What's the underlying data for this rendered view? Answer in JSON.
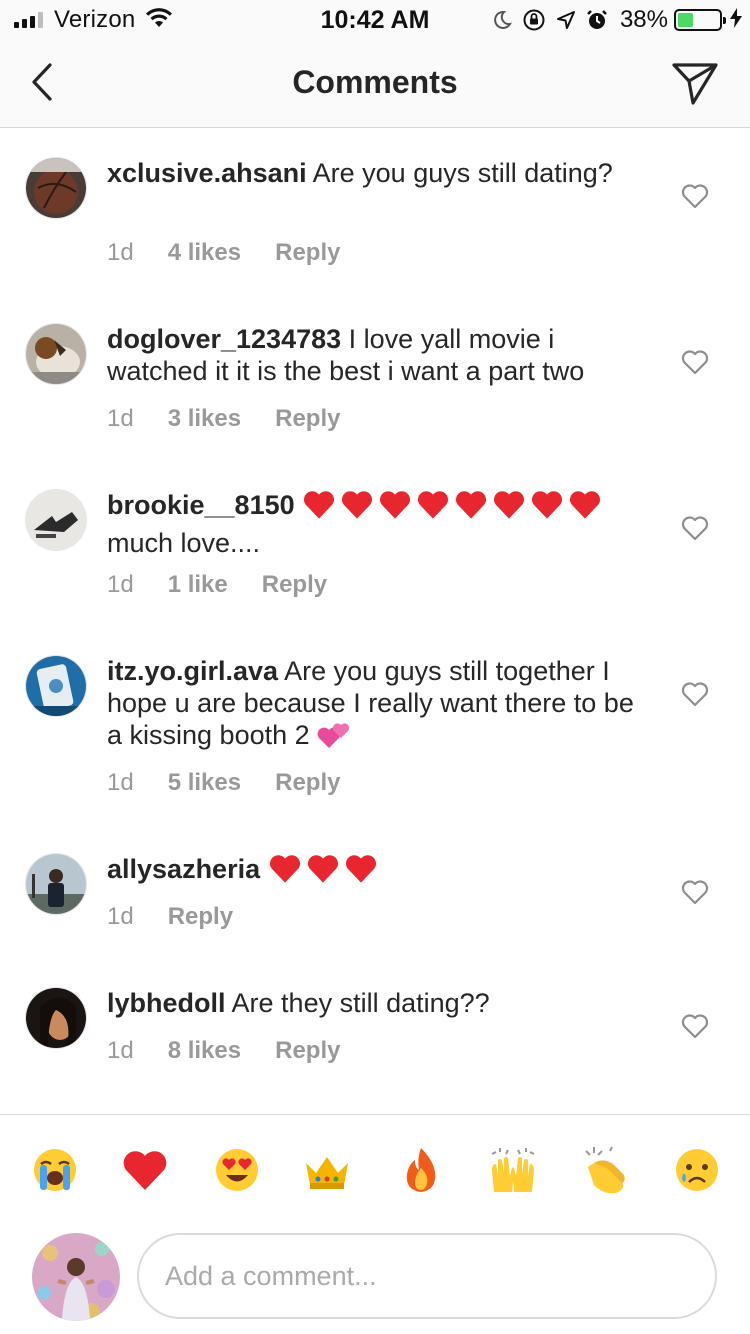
{
  "status_bar": {
    "carrier": "Verizon",
    "time": "10:42 AM",
    "battery_percent": "38%",
    "battery_level": 0.38,
    "battery_color": "#4cd964"
  },
  "header": {
    "title": "Comments",
    "back_icon": "chevron-left-icon",
    "share_icon": "paper-plane-icon"
  },
  "comments": [
    {
      "username": "xclusive.ahsani",
      "text": "Are you guys still dating?",
      "timestamp": "1d",
      "likes": "4 likes",
      "reply": "Reply"
    },
    {
      "username": "doglover_1234783",
      "text": "I love yall movie i watched it it is the best i want a part two",
      "timestamp": "1d",
      "likes": "3 likes",
      "reply": "Reply"
    },
    {
      "username": "brookie__8150",
      "hearts": 8,
      "text": "much love....",
      "timestamp": "1d",
      "likes": "1 like",
      "reply": "Reply"
    },
    {
      "username": "itz.yo.girl.ava",
      "text": "Are you guys still together I hope u are because I really want there to be a kissing booth 2",
      "trailing_emoji": "two-hearts-emoji",
      "timestamp": "1d",
      "likes": "5 likes",
      "reply": "Reply"
    },
    {
      "username": "allysazheria",
      "hearts": 3,
      "text": "",
      "timestamp": "1d",
      "likes": "",
      "reply": "Reply"
    },
    {
      "username": "lybhedoll",
      "text": "Are they still dating??",
      "timestamp": "1d",
      "likes": "8 likes",
      "reply": "Reply"
    }
  ],
  "quick_emojis": [
    "loudly-crying-face",
    "red-heart",
    "heart-eyes",
    "crown",
    "fire",
    "raising-hands",
    "clapping-hands",
    "crying-face"
  ],
  "composer": {
    "placeholder": "Add a comment..."
  }
}
